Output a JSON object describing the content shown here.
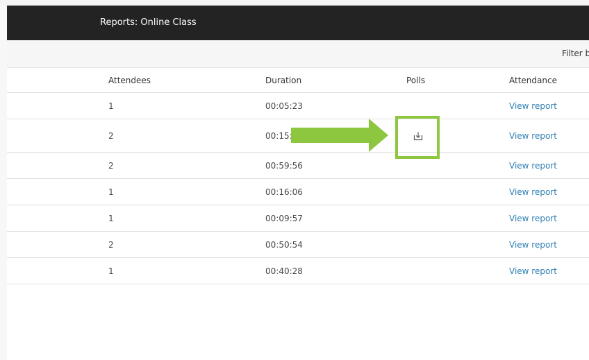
{
  "header": {
    "title": "Reports: Online Class"
  },
  "filterbar": {
    "label": "Filter b"
  },
  "table": {
    "columns": [
      "Attendees",
      "Duration",
      "Polls",
      "Attendance"
    ],
    "rows": [
      {
        "attendees": "1",
        "duration": "00:05:23",
        "has_poll": false,
        "attendance": "View report"
      },
      {
        "attendees": "2",
        "duration": "00:15:2",
        "has_poll": true,
        "attendance": "View report"
      },
      {
        "attendees": "2",
        "duration": "00:59:56",
        "has_poll": false,
        "attendance": "View report"
      },
      {
        "attendees": "1",
        "duration": "00:16:06",
        "has_poll": false,
        "attendance": "View report"
      },
      {
        "attendees": "1",
        "duration": "00:09:57",
        "has_poll": false,
        "attendance": "View report"
      },
      {
        "attendees": "2",
        "duration": "00:50:54",
        "has_poll": false,
        "attendance": "View report"
      },
      {
        "attendees": "1",
        "duration": "00:40:28",
        "has_poll": false,
        "attendance": "View report"
      }
    ]
  },
  "icons": {
    "poll_download": "download-icon"
  },
  "colors": {
    "titlebar": "#232323",
    "link": "#2f7fb3",
    "highlight": "#8dc63f"
  }
}
